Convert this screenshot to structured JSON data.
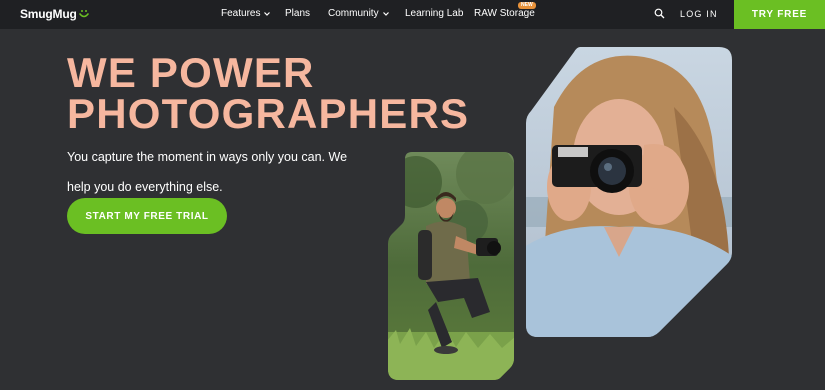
{
  "nav": {
    "brand": "SmugMug",
    "items": [
      {
        "label": "Features",
        "has_dropdown": true
      },
      {
        "label": "Plans",
        "has_dropdown": false
      },
      {
        "label": "Community",
        "has_dropdown": true
      },
      {
        "label": "Learning Lab",
        "has_dropdown": false
      },
      {
        "label": "RAW Storage",
        "has_dropdown": false
      }
    ],
    "new_badge": "NEW",
    "search_icon": "search-icon",
    "login": "LOG IN",
    "cta": "TRY FREE"
  },
  "hero": {
    "headline_line1": "WE POWER",
    "headline_line2": "PHOTOGRAPHERS",
    "subtext": "You capture the moment in ways only you can. We help you do everything else.",
    "cta": "START MY FREE TRIAL"
  },
  "colors": {
    "background": "#2f3033",
    "nav_background": "#1f2023",
    "accent_green": "#6bbf23",
    "headline_salmon": "#f6b79f",
    "badge_orange": "#e8923a"
  }
}
